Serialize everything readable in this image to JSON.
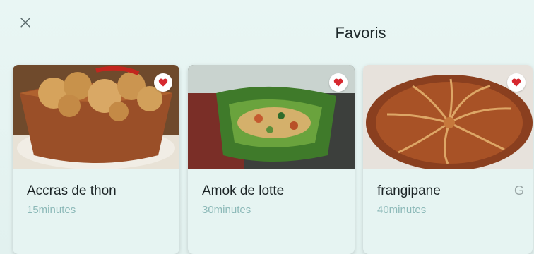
{
  "header": {
    "title": "Favoris",
    "close_icon": "close-icon"
  },
  "favorites": [
    {
      "name": "Accras de thon",
      "duration": "15minutes",
      "favorite_icon": "heart-icon"
    },
    {
      "name": "Amok de lotte",
      "duration": "30minutes",
      "favorite_icon": "heart-icon"
    },
    {
      "name": "frangipane",
      "duration": "40minutes",
      "favorite_icon": "heart-icon",
      "trailing": "G"
    }
  ],
  "colors": {
    "heart": "#d6282f",
    "background": "#e6f4f2",
    "duration_text": "#8cb9b8"
  }
}
